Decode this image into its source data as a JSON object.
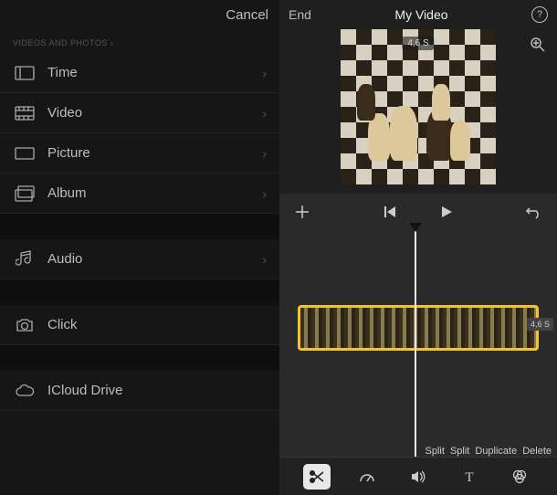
{
  "left_panel": {
    "cancel_label": "Cancel",
    "section_header": "VIDEOS AND PHOTOS ›",
    "items": [
      {
        "icon": "time-icon",
        "label": "Time"
      },
      {
        "icon": "video-icon",
        "label": "Video"
      },
      {
        "icon": "picture-icon",
        "label": "Picture"
      },
      {
        "icon": "album-icon",
        "label": "Album"
      }
    ],
    "audio_item": {
      "icon": "audio-icon",
      "label": "Audio"
    },
    "click_item": {
      "icon": "camera-icon",
      "label": "Click"
    },
    "icloud_item": {
      "icon": "icloud-icon",
      "label": "ICloud Drive"
    }
  },
  "right_panel": {
    "end_label": "End",
    "title": "My Video",
    "preview_duration": "4,6 S",
    "clip_duration": "4,6 S",
    "edit_actions": [
      "Split",
      "Split",
      "Duplicate",
      "Delete"
    ]
  },
  "tools": [
    {
      "name": "scissors-tool",
      "active": true
    },
    {
      "name": "speed-tool",
      "active": false
    },
    {
      "name": "volume-tool",
      "active": false
    },
    {
      "name": "text-tool",
      "active": false
    },
    {
      "name": "filter-tool",
      "active": false
    }
  ]
}
